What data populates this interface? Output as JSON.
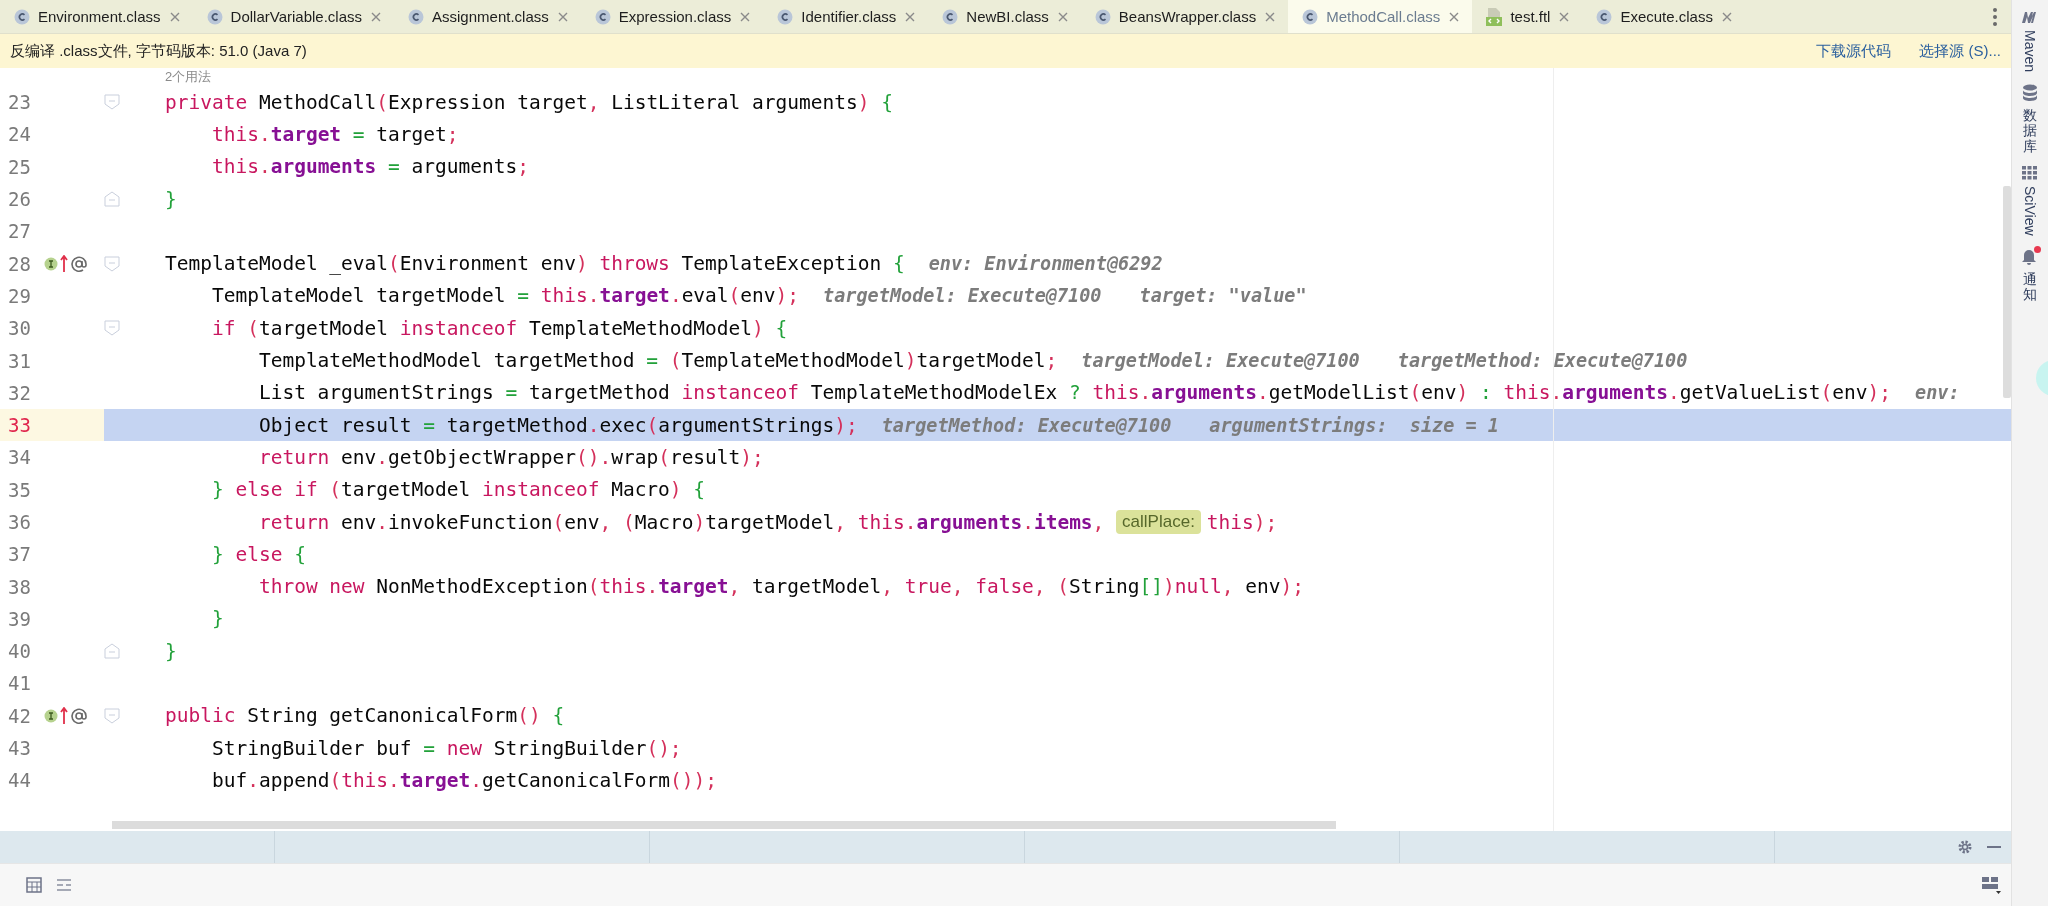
{
  "tabs": [
    {
      "label": "Environment.class",
      "kind": "class",
      "selected": false
    },
    {
      "label": "DollarVariable.class",
      "kind": "class",
      "selected": false
    },
    {
      "label": "Assignment.class",
      "kind": "class",
      "selected": false
    },
    {
      "label": "Expression.class",
      "kind": "class",
      "selected": false
    },
    {
      "label": "Identifier.class",
      "kind": "class",
      "selected": false
    },
    {
      "label": "NewBI.class",
      "kind": "class",
      "selected": false
    },
    {
      "label": "BeansWrapper.class",
      "kind": "class",
      "selected": false
    },
    {
      "label": "MethodCall.class",
      "kind": "class",
      "selected": true
    },
    {
      "label": "test.ftl",
      "kind": "template",
      "selected": false
    },
    {
      "label": "Execute.class",
      "kind": "class",
      "selected": false
    }
  ],
  "banner": {
    "text": "反编译 .class文件, 字节码版本: 51.0 (Java 7)",
    "links": [
      "下载源代码",
      "选择源 (S)..."
    ]
  },
  "editor": {
    "usage_hint": "2个用法",
    "lines": [
      {
        "number": "23",
        "kind": "fold-start",
        "selected": false,
        "gutter_icons": false,
        "tokens": [
          {
            "kind": "k",
            "text": "private "
          },
          {
            "kind": "t",
            "text": "MethodCall"
          },
          {
            "kind": "r",
            "text": "("
          },
          {
            "kind": "t",
            "text": "Expression target"
          },
          {
            "kind": "r",
            "text": ","
          },
          {
            "kind": "t",
            "text": " ListLiteral arguments"
          },
          {
            "kind": "r",
            "text": ")"
          },
          {
            "kind": "g",
            "text": " {"
          }
        ]
      },
      {
        "number": "24",
        "kind": "plain",
        "selected": false,
        "gutter_icons": false,
        "tokens": [
          {
            "kind": "k",
            "text": "    this"
          },
          {
            "kind": "r",
            "text": "."
          },
          {
            "kind": "f",
            "text": "target"
          },
          {
            "kind": "g",
            "text": " = "
          },
          {
            "kind": "t",
            "text": "target"
          },
          {
            "kind": "r",
            "text": ";"
          }
        ]
      },
      {
        "number": "25",
        "kind": "plain",
        "selected": false,
        "gutter_icons": false,
        "tokens": [
          {
            "kind": "k",
            "text": "    this"
          },
          {
            "kind": "r",
            "text": "."
          },
          {
            "kind": "f",
            "text": "arguments"
          },
          {
            "kind": "g",
            "text": " = "
          },
          {
            "kind": "t",
            "text": "arguments"
          },
          {
            "kind": "r",
            "text": ";"
          }
        ]
      },
      {
        "number": "26",
        "kind": "fold-end",
        "selected": false,
        "gutter_icons": false,
        "tokens": [
          {
            "kind": "g",
            "text": "}"
          }
        ]
      },
      {
        "number": "27",
        "kind": "plain",
        "selected": false,
        "gutter_icons": false
      },
      {
        "number": "28",
        "kind": "fold-start",
        "selected": false,
        "gutter_icons": true,
        "tokens": [
          {
            "kind": "t",
            "text": "TemplateModel _eval"
          },
          {
            "kind": "r",
            "text": "("
          },
          {
            "kind": "t",
            "text": "Environment env"
          },
          {
            "kind": "r",
            "text": ")"
          },
          {
            "kind": "k",
            "text": " throws"
          },
          {
            "kind": "t",
            "text": " TemplateException"
          },
          {
            "kind": "g",
            "text": " {"
          }
        ],
        "hints": [
          "env: Environment@6292"
        ]
      },
      {
        "number": "29",
        "kind": "plain",
        "selected": false,
        "gutter_icons": false,
        "tokens": [
          {
            "kind": "t",
            "text": "    TemplateModel targetModel"
          },
          {
            "kind": "g",
            "text": " = "
          },
          {
            "kind": "k",
            "text": "this"
          },
          {
            "kind": "r",
            "text": "."
          },
          {
            "kind": "f",
            "text": "target"
          },
          {
            "kind": "r",
            "text": "."
          },
          {
            "kind": "t",
            "text": "eval"
          },
          {
            "kind": "r",
            "text": "("
          },
          {
            "kind": "t",
            "text": "env"
          },
          {
            "kind": "r",
            "text": ");"
          }
        ],
        "hints": [
          "targetModel: Execute@7100",
          "target: \"value\""
        ]
      },
      {
        "number": "30",
        "kind": "fold-start",
        "selected": false,
        "gutter_icons": false,
        "tokens": [
          {
            "kind": "k",
            "text": "    if"
          },
          {
            "kind": "r",
            "text": " ("
          },
          {
            "kind": "t",
            "text": "targetModel "
          },
          {
            "kind": "k",
            "text": "instanceof"
          },
          {
            "kind": "t",
            "text": " TemplateMethodModel"
          },
          {
            "kind": "r",
            "text": ")"
          },
          {
            "kind": "g",
            "text": " {"
          }
        ]
      },
      {
        "number": "31",
        "kind": "plain",
        "selected": false,
        "gutter_icons": false,
        "tokens": [
          {
            "kind": "t",
            "text": "        TemplateMethodModel targetMethod"
          },
          {
            "kind": "g",
            "text": " = "
          },
          {
            "kind": "r",
            "text": "("
          },
          {
            "kind": "t",
            "text": "TemplateMethodModel"
          },
          {
            "kind": "r",
            "text": ")"
          },
          {
            "kind": "t",
            "text": "targetModel"
          },
          {
            "kind": "r",
            "text": ";"
          }
        ],
        "hints": [
          "targetModel: Execute@7100",
          "targetMethod: Execute@7100"
        ]
      },
      {
        "number": "32",
        "kind": "plain",
        "selected": false,
        "gutter_icons": false,
        "tokens": [
          {
            "kind": "t",
            "text": "        List argumentStrings"
          },
          {
            "kind": "g",
            "text": " = "
          },
          {
            "kind": "t",
            "text": "targetMethod "
          },
          {
            "kind": "k",
            "text": "instanceof"
          },
          {
            "kind": "t",
            "text": " TemplateMethodModelEx"
          },
          {
            "kind": "g",
            "text": " ? "
          },
          {
            "kind": "k",
            "text": "this"
          },
          {
            "kind": "r",
            "text": "."
          },
          {
            "kind": "f",
            "text": "arguments"
          },
          {
            "kind": "r",
            "text": "."
          },
          {
            "kind": "t",
            "text": "getModelList"
          },
          {
            "kind": "r",
            "text": "("
          },
          {
            "kind": "t",
            "text": "env"
          },
          {
            "kind": "r",
            "text": ")"
          },
          {
            "kind": "g",
            "text": " : "
          },
          {
            "kind": "k",
            "text": "this"
          },
          {
            "kind": "r",
            "text": "."
          },
          {
            "kind": "f",
            "text": "arguments"
          },
          {
            "kind": "r",
            "text": "."
          },
          {
            "kind": "t",
            "text": "getValueList"
          },
          {
            "kind": "r",
            "text": "("
          },
          {
            "kind": "t",
            "text": "env"
          },
          {
            "kind": "r",
            "text": ");"
          }
        ],
        "hints": [
          "env:"
        ]
      },
      {
        "number": "33",
        "kind": "plain",
        "selected": true,
        "gutter_icons": false,
        "tokens": [
          {
            "kind": "t",
            "text": "        Object result"
          },
          {
            "kind": "g",
            "text": " = "
          },
          {
            "kind": "t",
            "text": "targetMethod"
          },
          {
            "kind": "r",
            "text": "."
          },
          {
            "kind": "t",
            "text": "exec"
          },
          {
            "kind": "r",
            "text": "("
          },
          {
            "kind": "t",
            "text": "argumentStrings"
          },
          {
            "kind": "r",
            "text": ");"
          }
        ],
        "hints": [
          "targetMethod: Execute@7100",
          "argumentStrings:  size = 1"
        ]
      },
      {
        "number": "34",
        "kind": "plain",
        "selected": false,
        "gutter_icons": false,
        "tokens": [
          {
            "kind": "k",
            "text": "        return"
          },
          {
            "kind": "t",
            "text": " env"
          },
          {
            "kind": "r",
            "text": "."
          },
          {
            "kind": "t",
            "text": "getObjectWrapper"
          },
          {
            "kind": "r",
            "text": "()."
          },
          {
            "kind": "t",
            "text": "wrap"
          },
          {
            "kind": "r",
            "text": "("
          },
          {
            "kind": "t",
            "text": "result"
          },
          {
            "kind": "r",
            "text": ");"
          }
        ]
      },
      {
        "number": "35",
        "kind": "plain",
        "selected": false,
        "gutter_icons": false,
        "tokens": [
          {
            "kind": "g",
            "text": "    }"
          },
          {
            "kind": "k",
            "text": " else if"
          },
          {
            "kind": "r",
            "text": " ("
          },
          {
            "kind": "t",
            "text": "targetModel "
          },
          {
            "kind": "k",
            "text": "instanceof"
          },
          {
            "kind": "t",
            "text": " Macro"
          },
          {
            "kind": "r",
            "text": ")"
          },
          {
            "kind": "g",
            "text": " {"
          }
        ]
      },
      {
        "number": "36",
        "kind": "plain",
        "selected": false,
        "gutter_icons": false,
        "tokens": [
          {
            "kind": "k",
            "text": "        return"
          },
          {
            "kind": "t",
            "text": " env"
          },
          {
            "kind": "r",
            "text": "."
          },
          {
            "kind": "t",
            "text": "invokeFunction"
          },
          {
            "kind": "r",
            "text": "("
          },
          {
            "kind": "t",
            "text": "env"
          },
          {
            "kind": "r",
            "text": ", ("
          },
          {
            "kind": "t",
            "text": "Macro"
          },
          {
            "kind": "r",
            "text": ")"
          },
          {
            "kind": "t",
            "text": "targetModel"
          },
          {
            "kind": "r",
            "text": ", "
          },
          {
            "kind": "k",
            "text": "this"
          },
          {
            "kind": "r",
            "text": "."
          },
          {
            "kind": "f",
            "text": "arguments"
          },
          {
            "kind": "r",
            "text": "."
          },
          {
            "kind": "f",
            "text": "items"
          },
          {
            "kind": "r",
            "text": ", "
          },
          {
            "kind": "inlay",
            "text": "callPlace:"
          },
          {
            "kind": "k",
            "text": "this"
          },
          {
            "kind": "r",
            "text": ");"
          }
        ]
      },
      {
        "number": "37",
        "kind": "plain",
        "selected": false,
        "gutter_icons": false,
        "tokens": [
          {
            "kind": "g",
            "text": "    }"
          },
          {
            "kind": "k",
            "text": " else"
          },
          {
            "kind": "g",
            "text": " {"
          }
        ]
      },
      {
        "number": "38",
        "kind": "plain",
        "selected": false,
        "gutter_icons": false,
        "tokens": [
          {
            "kind": "k",
            "text": "        throw new"
          },
          {
            "kind": "t",
            "text": " NonMethodException"
          },
          {
            "kind": "r",
            "text": "("
          },
          {
            "kind": "k",
            "text": "this"
          },
          {
            "kind": "r",
            "text": "."
          },
          {
            "kind": "f",
            "text": "target"
          },
          {
            "kind": "r",
            "text": ","
          },
          {
            "kind": "t",
            "text": " targetModel"
          },
          {
            "kind": "r",
            "text": ", "
          },
          {
            "kind": "k",
            "text": "true"
          },
          {
            "kind": "r",
            "text": ", "
          },
          {
            "kind": "k",
            "text": "false"
          },
          {
            "kind": "r",
            "text": ", ("
          },
          {
            "kind": "t",
            "text": "String"
          },
          {
            "kind": "g",
            "text": "[]"
          },
          {
            "kind": "r",
            "text": ")"
          },
          {
            "kind": "k",
            "text": "null"
          },
          {
            "kind": "r",
            "text": ","
          },
          {
            "kind": "t",
            "text": " env"
          },
          {
            "kind": "r",
            "text": ");"
          }
        ]
      },
      {
        "number": "39",
        "kind": "plain",
        "selected": false,
        "gutter_icons": false,
        "tokens": [
          {
            "kind": "g",
            "text": "    }"
          }
        ]
      },
      {
        "number": "40",
        "kind": "fold-end",
        "selected": false,
        "gutter_icons": false,
        "tokens": [
          {
            "kind": "g",
            "text": "}"
          }
        ]
      },
      {
        "number": "41",
        "kind": "plain",
        "selected": false,
        "gutter_icons": false
      },
      {
        "number": "42",
        "kind": "fold-start",
        "selected": false,
        "gutter_icons": true,
        "tokens": [
          {
            "kind": "k",
            "text": "public"
          },
          {
            "kind": "t",
            "text": " String getCanonicalForm"
          },
          {
            "kind": "r",
            "text": "()"
          },
          {
            "kind": "g",
            "text": " {"
          }
        ]
      },
      {
        "number": "43",
        "kind": "plain",
        "selected": false,
        "gutter_icons": false,
        "tokens": [
          {
            "kind": "t",
            "text": "    StringBuilder buf"
          },
          {
            "kind": "g",
            "text": " = "
          },
          {
            "kind": "k",
            "text": "new"
          },
          {
            "kind": "t",
            "text": " StringBuilder"
          },
          {
            "kind": "r",
            "text": "();"
          }
        ]
      },
      {
        "number": "44",
        "kind": "plain",
        "selected": false,
        "gutter_icons": false,
        "tokens": [
          {
            "kind": "t",
            "text": "    buf"
          },
          {
            "kind": "r",
            "text": "."
          },
          {
            "kind": "t",
            "text": "append"
          },
          {
            "kind": "r",
            "text": "("
          },
          {
            "kind": "k",
            "text": "this"
          },
          {
            "kind": "r",
            "text": "."
          },
          {
            "kind": "f",
            "text": "target"
          },
          {
            "kind": "r",
            "text": "."
          },
          {
            "kind": "t",
            "text": "getCanonicalForm"
          },
          {
            "kind": "r",
            "text": "());"
          }
        ]
      }
    ]
  },
  "tool_strip": [
    {
      "label": "Maven",
      "kind": "maven",
      "badge": false
    },
    {
      "label": "数据库",
      "kind": "database",
      "badge": false
    },
    {
      "label": "SciView",
      "kind": "grid",
      "badge": false
    },
    {
      "label": "通知",
      "kind": "bell",
      "badge": true
    }
  ]
}
